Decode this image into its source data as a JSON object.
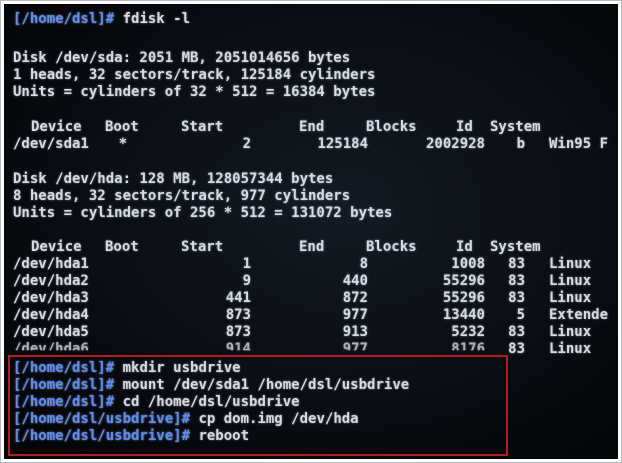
{
  "colors": {
    "prompt": "#5b8cff",
    "text": "#d6dbe3",
    "highlight_border": "#b01e24",
    "background": "#07090d"
  },
  "header": {
    "prompt": "[/home/dsl]#",
    "command": "fdisk -l"
  },
  "disk1": {
    "line1": "Disk /dev/sda: 2051 MB, 2051014656 bytes",
    "line2": "1 heads, 32 sectors/track, 125184 cylinders",
    "line3": "Units = cylinders of 32 * 512 = 16384 bytes",
    "columns": {
      "device": "Device",
      "boot": "Boot",
      "start": "Start",
      "end": "End",
      "blocks": "Blocks",
      "id": "Id",
      "system": "System"
    },
    "rows": [
      {
        "device": "/dev/sda1",
        "boot": "*",
        "start": "2",
        "end": "125184",
        "blocks": "2002928",
        "id": "b",
        "system": "Win95 F"
      }
    ]
  },
  "disk2": {
    "line1": "Disk /dev/hda: 128 MB, 128057344 bytes",
    "line2": "8 heads, 32 sectors/track, 977 cylinders",
    "line3": "Units = cylinders of 256 * 512 = 131072 bytes",
    "columns": {
      "device": "Device",
      "boot": "Boot",
      "start": "Start",
      "end": "End",
      "blocks": "Blocks",
      "id": "Id",
      "system": "System"
    },
    "rows": [
      {
        "device": "/dev/hda1",
        "start": "1",
        "end": "8",
        "blocks": "1008",
        "id": "83",
        "system": "Linux"
      },
      {
        "device": "/dev/hda2",
        "start": "9",
        "end": "440",
        "blocks": "55296",
        "id": "83",
        "system": "Linux"
      },
      {
        "device": "/dev/hda3",
        "start": "441",
        "end": "872",
        "blocks": "55296",
        "id": "83",
        "system": "Linux"
      },
      {
        "device": "/dev/hda4",
        "start": "873",
        "end": "977",
        "blocks": "13440",
        "id": "5",
        "system": "Extende"
      },
      {
        "device": "/dev/hda5",
        "start": "873",
        "end": "913",
        "blocks": "5232",
        "id": "83",
        "system": "Linux"
      },
      {
        "device": "/dev/hda6",
        "start": "914",
        "end": "977",
        "blocks": "8176",
        "id": "83",
        "system": "Linux"
      }
    ]
  },
  "commands": [
    {
      "prompt": "[/home/dsl]#",
      "command": "mkdir usbdrive"
    },
    {
      "prompt": "[/home/dsl]#",
      "command": "mount /dev/sda1 /home/dsl/usbdrive"
    },
    {
      "prompt": "[/home/dsl]#",
      "command": "cd /home/dsl/usbdrive"
    },
    {
      "prompt": "[/home/dsl/usbdrive]#",
      "command": "cp dom.img /dev/hda"
    },
    {
      "prompt": "[/home/dsl/usbdrive]#",
      "command": "reboot"
    }
  ]
}
